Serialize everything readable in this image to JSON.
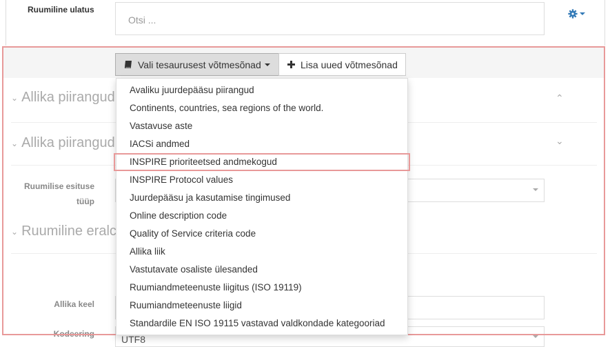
{
  "extent": {
    "label": "Ruumiline ulatus",
    "search_placeholder": "Otsi ..."
  },
  "toolbar": {
    "thesaurus_button": "Vali tesaurusest võtmesõnad",
    "add_button": "Lisa uued võtmesõnad"
  },
  "sections": {
    "s1": "Allika piirangud",
    "s2": "Allika piirangud",
    "s3": "Ruumiline eralc"
  },
  "fields": {
    "repr_type_line1": "Ruumilise esituse",
    "repr_type_line2": "tüüp",
    "language": "Allika keel",
    "encoding": "Kodeering",
    "encoding_value": "UTF8"
  },
  "dropdown": {
    "items": [
      "Avaliku juurdepääsu piirangud",
      "Continents, countries, sea regions of the world.",
      "Vastavuse aste",
      "IACSi andmed",
      "INSPIRE prioriteetsed andmekogud",
      "INSPIRE Protocol values",
      "Juurdepääsu ja kasutamise tingimused",
      "Online description code",
      "Quality of Service criteria code",
      "Allika liik",
      "Vastutavate osaliste ülesanded",
      "Ruumiandmeteenuste liigitus (ISO 19119)",
      "Ruumiandmeteenuste liigid",
      "Standardile EN ISO 19115 vastavad valdkondade kategooriad"
    ],
    "highlighted_index": 4
  },
  "icons": {
    "settings": "gear-icon",
    "book": "book-icon",
    "plus": "plus-icon",
    "caret": "caret-down-icon"
  },
  "colors": {
    "highlight_border": "#e89999",
    "gear": "#337ab7"
  }
}
